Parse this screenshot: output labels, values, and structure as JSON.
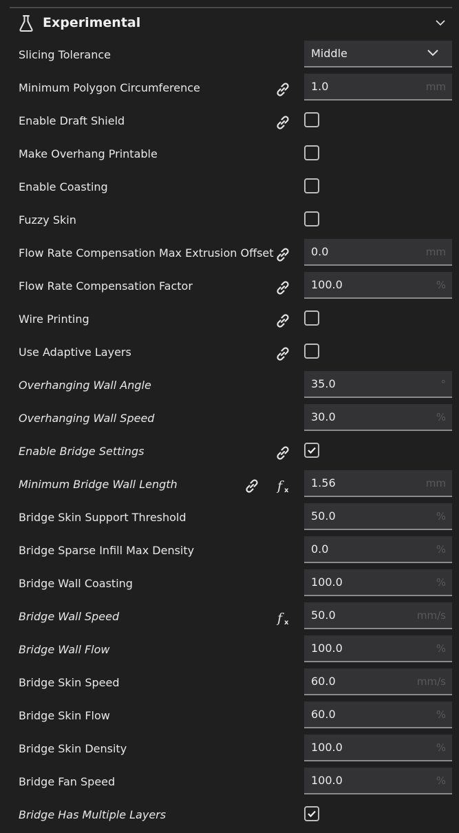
{
  "section": {
    "title": "Experimental"
  },
  "rows": [
    {
      "label": "Slicing Tolerance",
      "value": "Middle"
    },
    {
      "label": "Minimum Polygon Circumference",
      "value": "1.0",
      "unit": "mm"
    },
    {
      "label": "Enable Draft Shield",
      "checked": false
    },
    {
      "label": "Make Overhang Printable",
      "checked": false
    },
    {
      "label": "Enable Coasting",
      "checked": false
    },
    {
      "label": "Fuzzy Skin",
      "checked": false
    },
    {
      "label": "Flow Rate Compensation Max Extrusion Offset",
      "value": "0.0",
      "unit": "mm"
    },
    {
      "label": "Flow Rate Compensation Factor",
      "value": "100.0",
      "unit": "%"
    },
    {
      "label": "Wire Printing",
      "checked": false
    },
    {
      "label": "Use Adaptive Layers",
      "checked": false
    },
    {
      "label": "Overhanging Wall Angle",
      "value": "35.0",
      "unit": "°"
    },
    {
      "label": "Overhanging Wall Speed",
      "value": "30.0",
      "unit": "%"
    },
    {
      "label": "Enable Bridge Settings",
      "checked": true
    },
    {
      "label": "Minimum Bridge Wall Length",
      "value": "1.56",
      "unit": "mm"
    },
    {
      "label": "Bridge Skin Support Threshold",
      "value": "50.0",
      "unit": "%"
    },
    {
      "label": "Bridge Sparse Infill Max Density",
      "value": "0.0",
      "unit": "%"
    },
    {
      "label": "Bridge Wall Coasting",
      "value": "100.0",
      "unit": "%"
    },
    {
      "label": "Bridge Wall Speed",
      "value": "50.0",
      "unit": "mm/s"
    },
    {
      "label": "Bridge Wall Flow",
      "value": "100.0",
      "unit": "%"
    },
    {
      "label": "Bridge Skin Speed",
      "value": "60.0",
      "unit": "mm/s"
    },
    {
      "label": "Bridge Skin Flow",
      "value": "60.0",
      "unit": "%"
    },
    {
      "label": "Bridge Skin Density",
      "value": "100.0",
      "unit": "%"
    },
    {
      "label": "Bridge Fan Speed",
      "value": "100.0",
      "unit": "%"
    },
    {
      "label": "Bridge Has Multiple Layers",
      "checked": true
    }
  ]
}
